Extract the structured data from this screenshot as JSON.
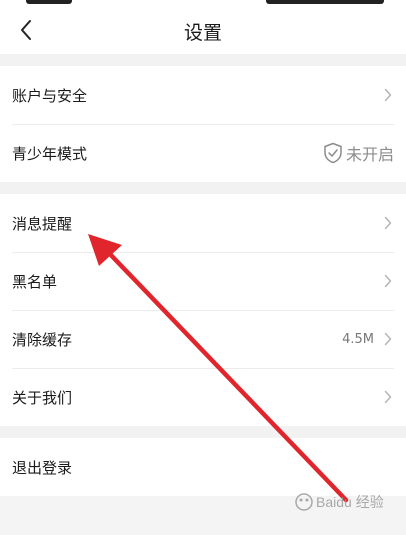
{
  "header": {
    "title": "设置"
  },
  "groups": [
    {
      "items": [
        {
          "label": "账户与安全"
        },
        {
          "label": "青少年模式",
          "value": "未开启"
        }
      ]
    },
    {
      "items": [
        {
          "label": "消息提醒"
        },
        {
          "label": "黑名单"
        },
        {
          "label": "清除缓存",
          "value": "4.5M"
        },
        {
          "label": "关于我们"
        }
      ]
    },
    {
      "items": [
        {
          "label": "退出登录"
        }
      ]
    }
  ],
  "icons": {
    "back": "chevron-left-icon",
    "chevron": "chevron-right-icon",
    "youth_mode": "shield-check-icon"
  },
  "colors": {
    "annotation_arrow": "#e0262c",
    "page_background": "#f2f2f2",
    "row_background": "#ffffff"
  },
  "watermark": "Baidu 经验"
}
